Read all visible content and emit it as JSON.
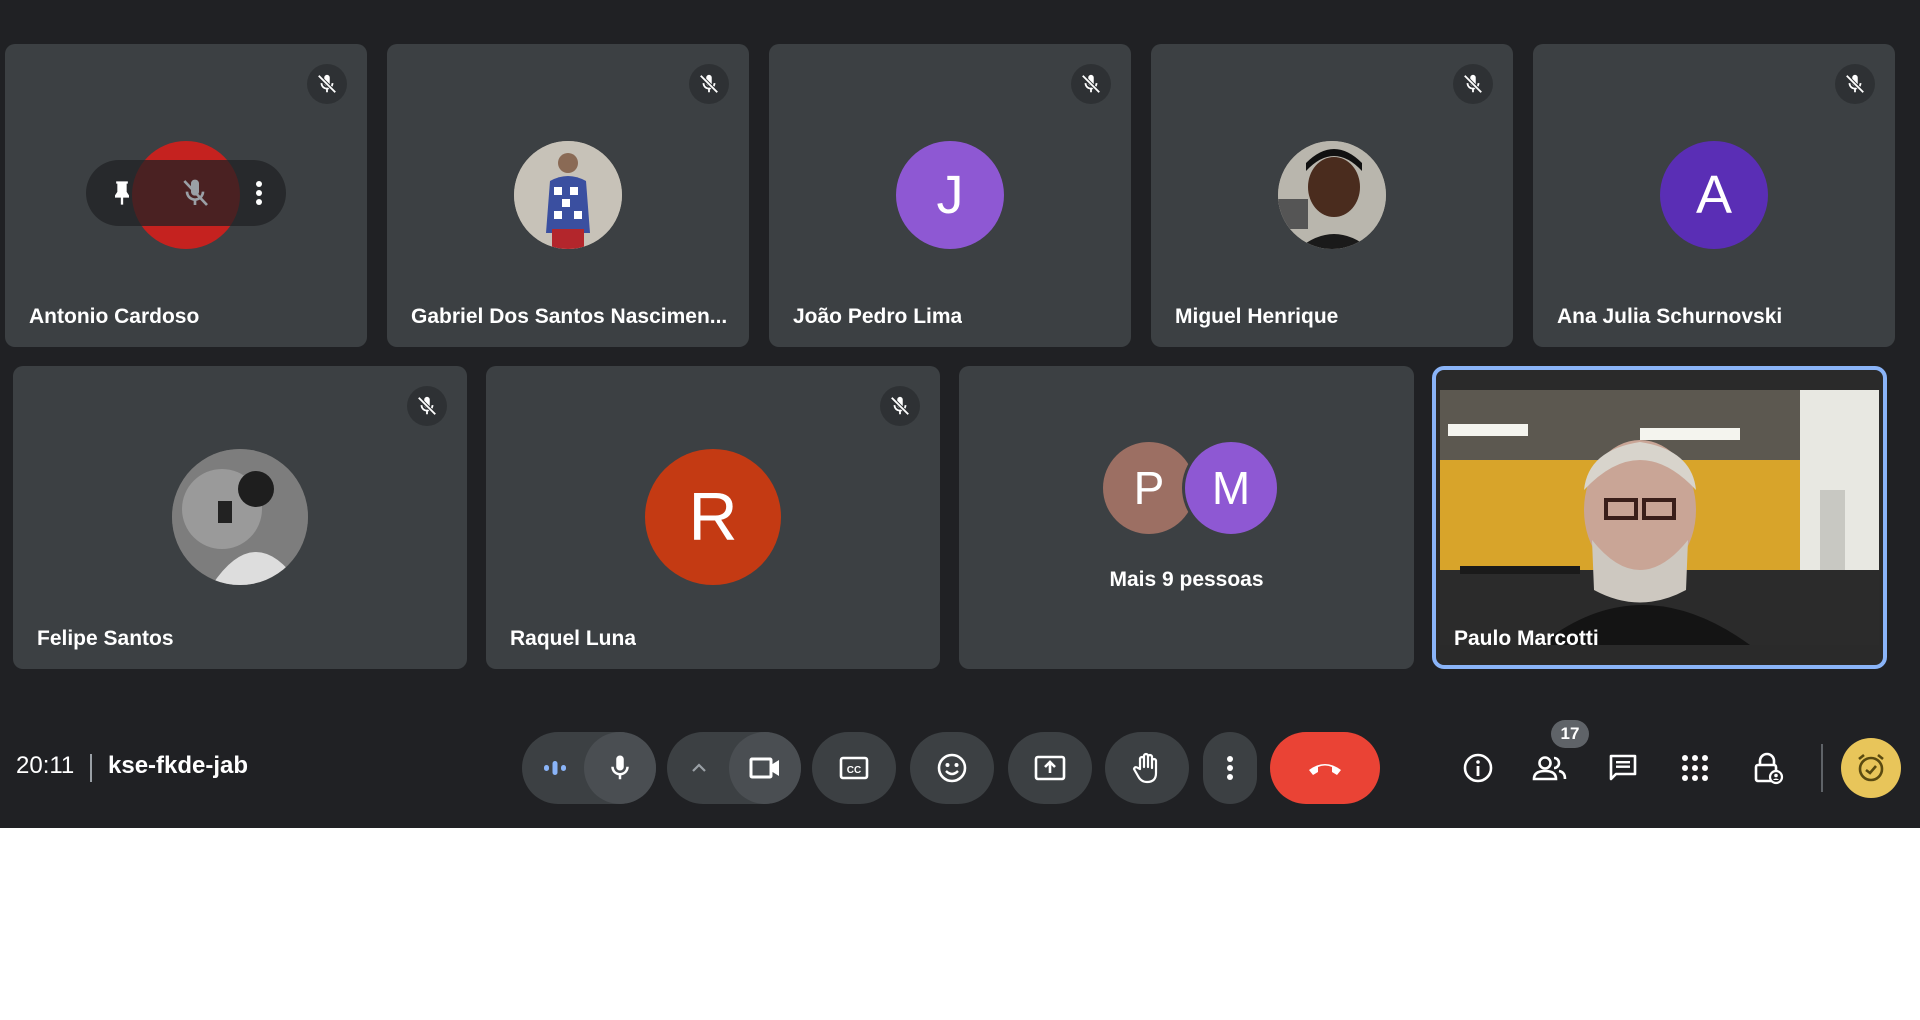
{
  "participants": [
    {
      "name": "Antonio Cardoso",
      "avatar_color": "#c5221f",
      "hover_controls": [
        "pin-icon",
        "mic-off-icon",
        "more-vert-icon"
      ]
    },
    {
      "name": "Gabriel Dos Santos Nascimen...",
      "avatar_type": "photo"
    },
    {
      "name": "João Pedro Lima",
      "avatar_letter": "J",
      "avatar_color": "#8e58d3"
    },
    {
      "name": "Miguel Henrique",
      "avatar_type": "photo"
    },
    {
      "name": "Ana Julia Schurnovski",
      "avatar_letter": "A",
      "avatar_color": "#5a2eb5"
    },
    {
      "name": "Felipe Santos",
      "avatar_type": "photo"
    },
    {
      "name": "Raquel Luna",
      "avatar_letter": "R",
      "avatar_color": "#c43a13"
    },
    {
      "name": "Paulo Marcotti",
      "avatar_type": "video",
      "highlight_color": "#8ab4f8"
    }
  ],
  "others": {
    "label": "Mais 9 pessoas",
    "avatars": [
      {
        "letter": "P",
        "color": "#9c6f63"
      },
      {
        "letter": "M",
        "color": "#8e58d3"
      }
    ]
  },
  "meeting": {
    "time": "20:11",
    "code": "kse-fkde-jab"
  },
  "controls": [
    "audio-level-icon",
    "mic-icon",
    "chevron-up-icon",
    "camera-icon",
    "captions-icon",
    "emoji-icon",
    "present-icon",
    "raise-hand-icon",
    "more-vert-icon",
    "hang-up-icon"
  ],
  "right_controls": [
    "info-icon",
    "people-icon",
    "chat-icon",
    "apps-icon",
    "host-controls-icon"
  ],
  "people_count": "17",
  "colors": {
    "background": "#202124",
    "tile": "#3c4043",
    "hangup": "#ea4335",
    "accent": "#8ab4f8",
    "timer": "#e8c55a"
  }
}
